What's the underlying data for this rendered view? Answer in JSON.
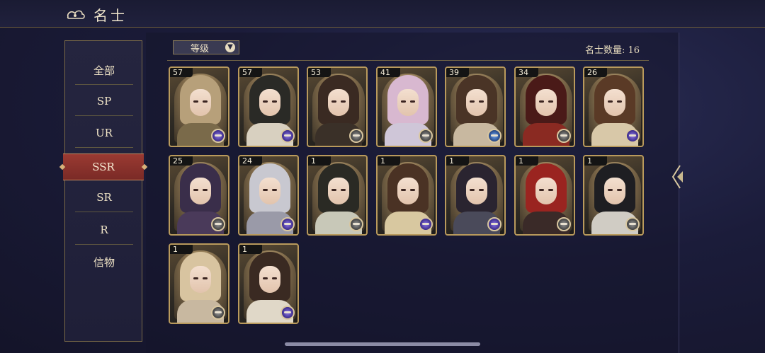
{
  "header": {
    "title": "名士"
  },
  "sidebar": {
    "items": [
      {
        "label": "全部"
      },
      {
        "label": "SP"
      },
      {
        "label": "UR"
      },
      {
        "label": "SSR"
      },
      {
        "label": "SR"
      },
      {
        "label": "R"
      },
      {
        "label": "信物"
      }
    ],
    "active": "SSR"
  },
  "toolbar": {
    "sort_label": "等级",
    "count_text": "名士数量: 16"
  },
  "cards": [
    {
      "level": "57",
      "badge": "purple-badge-icon",
      "hair": "#b7a07a",
      "robe": "#7a6a4a"
    },
    {
      "level": "57",
      "badge": "purple-badge-icon",
      "hair": "#2a2a26",
      "robe": "#d8d0c0"
    },
    {
      "level": "53",
      "badge": "gray-badge-icon",
      "hair": "#3a2a22",
      "robe": "#3a3028"
    },
    {
      "level": "41",
      "badge": "gray-badge-icon",
      "hair": "#d8b8d0",
      "robe": "#cfc6d8"
    },
    {
      "level": "39",
      "badge": "blue-badge-icon",
      "hair": "#4a3426",
      "robe": "#c8b8a0"
    },
    {
      "level": "34",
      "badge": "gray-badge-icon",
      "hair": "#4a1a18",
      "robe": "#8a2a22"
    },
    {
      "level": "26",
      "badge": "purple-badge-icon",
      "hair": "#5a3a26",
      "robe": "#d8c8a8"
    },
    {
      "level": "25",
      "badge": "gray-badge-icon",
      "hair": "#3a2e4a",
      "robe": "#4a3a5a"
    },
    {
      "level": "24",
      "badge": "purple-badge-icon",
      "hair": "#c8c8d0",
      "robe": "#9a9aa8"
    },
    {
      "level": "1",
      "badge": "gray-badge-icon",
      "hair": "#2a2a24",
      "robe": "#c8c8b8"
    },
    {
      "level": "1",
      "badge": "purple-badge-icon",
      "hair": "#4a3224",
      "robe": "#d8c8a0"
    },
    {
      "level": "1",
      "badge": "purple-badge-icon",
      "hair": "#2a2430",
      "robe": "#4a4a5a"
    },
    {
      "level": "1",
      "badge": "gray-badge-icon",
      "hair": "#9a2420",
      "robe": "#3a2a28"
    },
    {
      "level": "1",
      "badge": "gray-badge-icon",
      "hair": "#1e1e22",
      "robe": "#d0ccc4"
    },
    {
      "level": "1",
      "badge": "gray-badge-icon",
      "hair": "#d8c4a0",
      "robe": "#c8b8a0"
    },
    {
      "level": "1",
      "badge": "purple-badge-icon",
      "hair": "#3a2a22",
      "robe": "#e0d8c8"
    }
  ]
}
